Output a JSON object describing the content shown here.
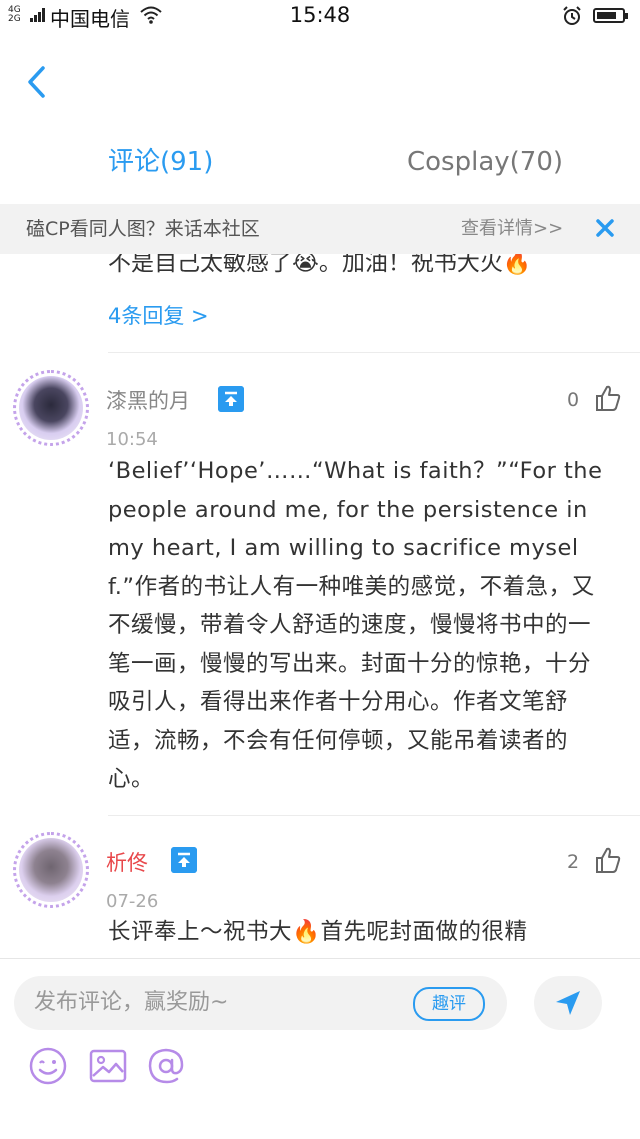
{
  "status_bar": {
    "network_top": "4G",
    "network_bottom": "2G",
    "carrier": "中国电信",
    "time": "15:48"
  },
  "tabs": [
    {
      "label": "评论(91)",
      "active": true
    },
    {
      "label": "Cosplay(70)",
      "active": false
    }
  ],
  "banner": {
    "text": "磕CP看同人图？来话本社区",
    "link": "查看详情>>"
  },
  "prev_comment": {
    "cut_text": "不是自己太敏感了😭。加油！祝书大火🔥",
    "replies_link": "4条回复 >"
  },
  "comments": [
    {
      "user": "漆黑的月",
      "user_color": "#888888",
      "likes": "0",
      "time": "10:54",
      "text": "‘Belief’‘Hope’……“What is faith？”“For the people around me, for the persistence in my heart, I am willing to sacrifice myself.”作者的书让人有一种唯美的感觉，不着急，又不缓慢，带着令人舒适的速度，慢慢将书中的一笔一画，慢慢的写出来。封面十分的惊艳，十分吸引人，看得出来作者十分用心。作者文笔舒适，流畅，不会有任何停顿，又能吊着读者的心。"
    },
    {
      "user": "析佟",
      "user_color": "#e8484b",
      "likes": "2",
      "time": "07-26",
      "text": "长评奉上～祝书大🔥首先呢封面做的很精"
    }
  ],
  "composer": {
    "placeholder": "发布评论，赢奖励~",
    "qp_label": "趣评"
  },
  "colors": {
    "accent": "#2a9bf0",
    "emoji_tool": "#b68be8"
  },
  "icons": [
    "back-arrow-icon",
    "wifi-icon",
    "alarm-icon",
    "battery-icon",
    "close-icon",
    "top-badge-icon",
    "thumbs-up-icon",
    "send-icon",
    "emoji-icon",
    "image-icon",
    "mention-icon"
  ]
}
